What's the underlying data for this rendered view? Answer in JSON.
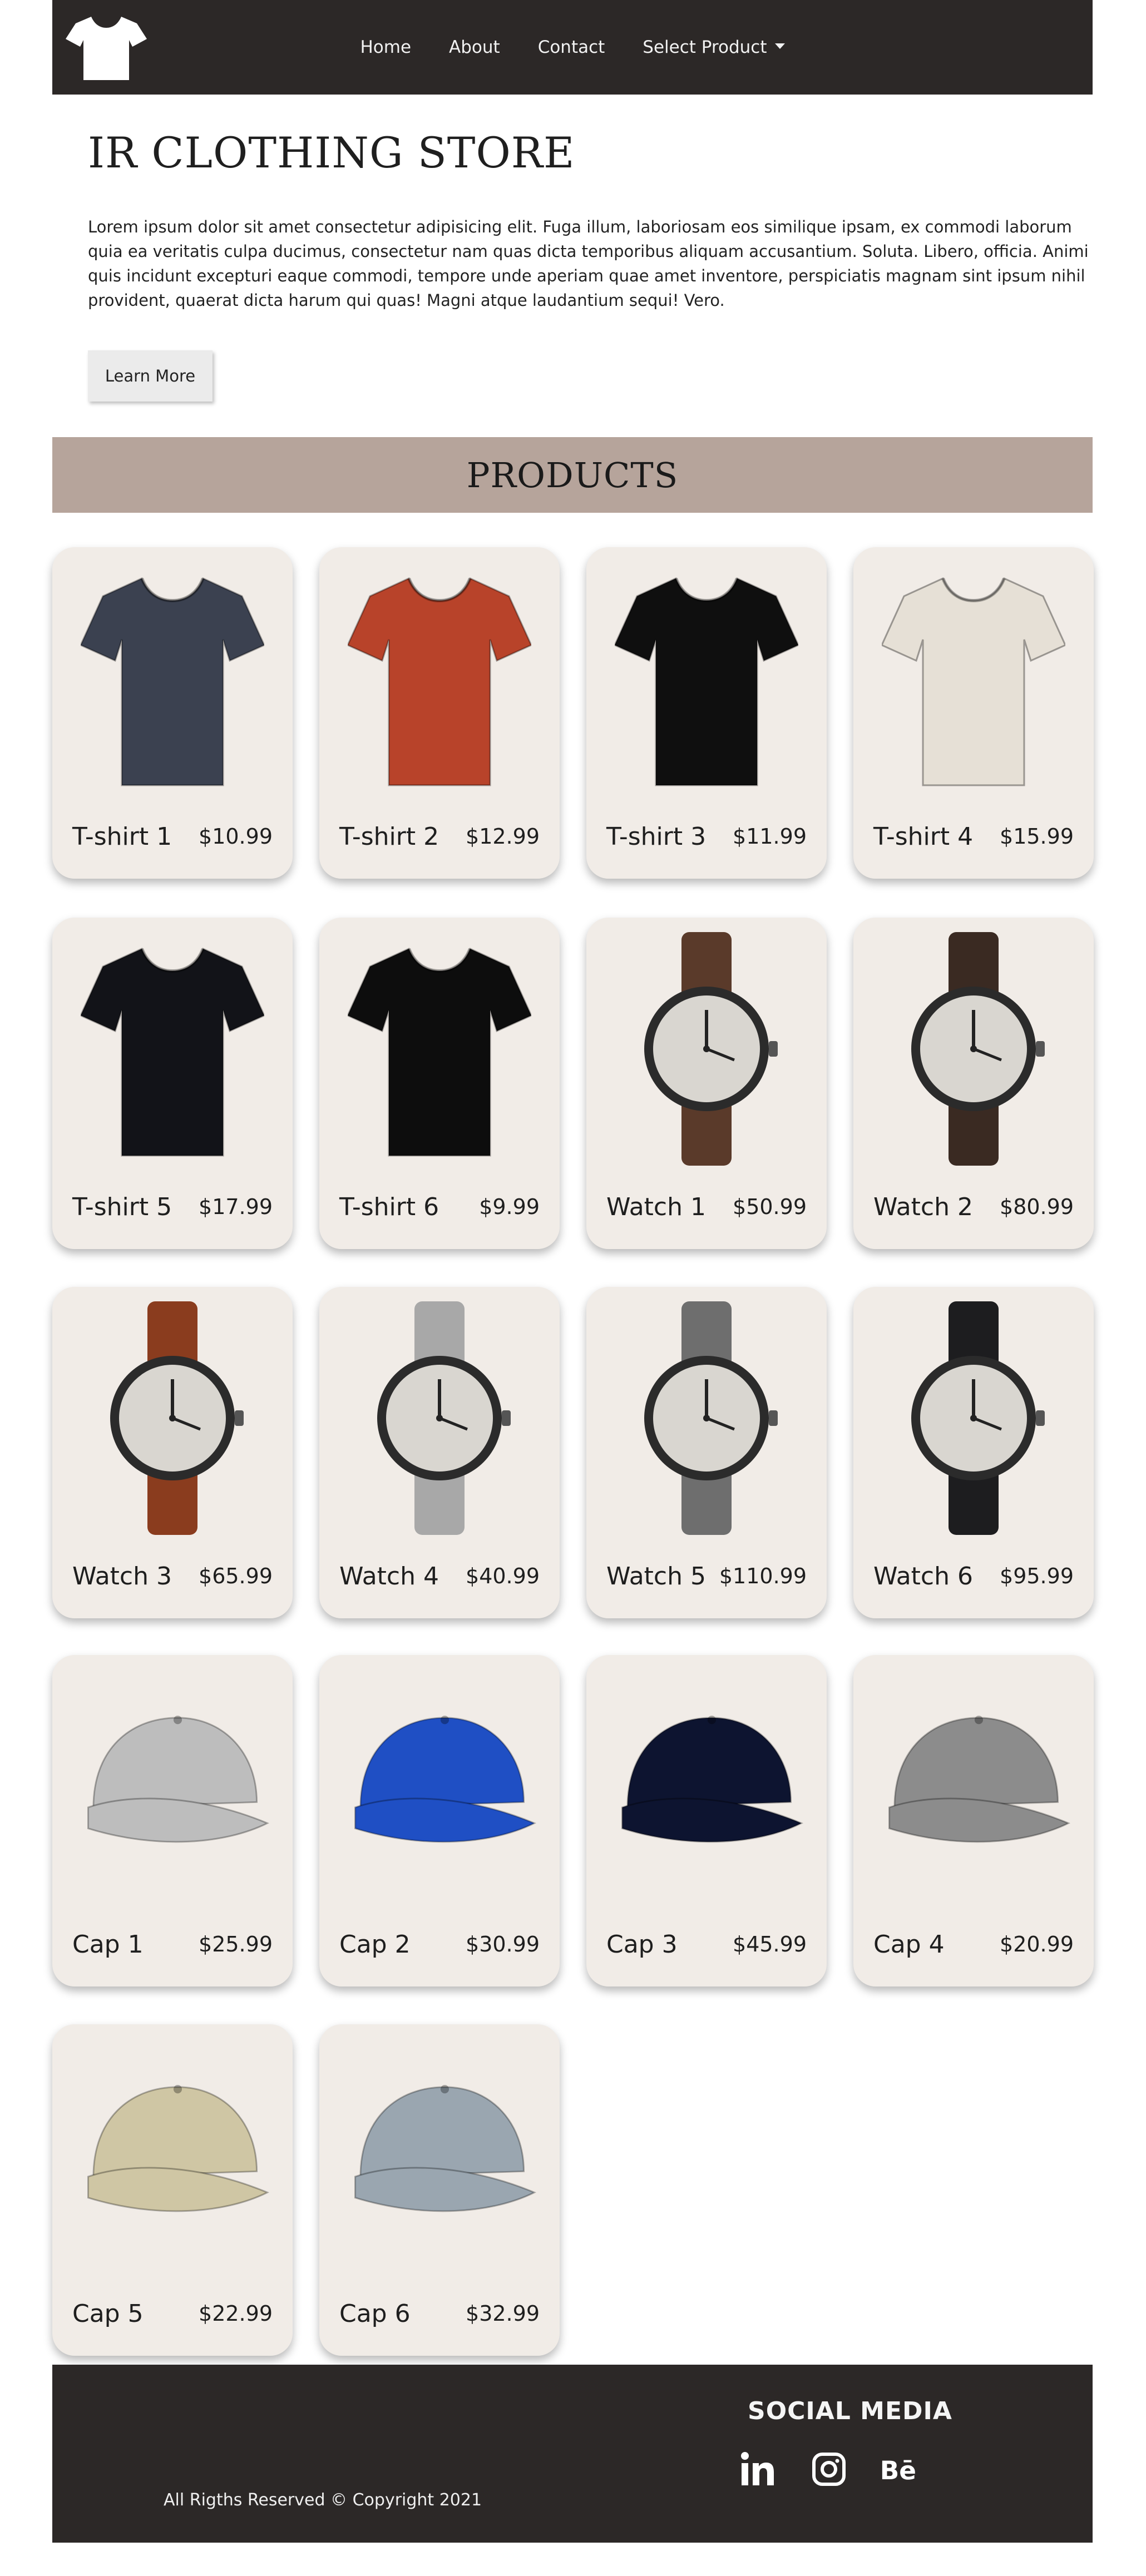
{
  "nav": {
    "logo_icon": "tshirt-icon",
    "links": [
      {
        "label": "Home"
      },
      {
        "label": "About"
      },
      {
        "label": "Contact"
      },
      {
        "label": "Select Product"
      }
    ]
  },
  "hero": {
    "title": "IR CLOTHING STORE",
    "text": "Lorem ipsum dolor sit amet consectetur adipisicing elit. Fuga illum, laboriosam eos similique ipsam, ex commodi laborum quia ea veritatis culpa ducimus, consectetur nam quas dicta temporibus aliquam accusantium. Soluta. Libero, officia. Animi quis incidunt excepturi eaque commodi, tempore unde aperiam quae amet inventore, perspiciatis magnam sint ipsum nihil provident, quaerat dicta harum qui quas! Magni atque laudantium sequi! Vero.",
    "button": "Learn More"
  },
  "products_heading": "PRODUCTS",
  "products": [
    {
      "name": "T-shirt 1",
      "price": "$10.99",
      "kind": "tshirt",
      "color": "#3b4150"
    },
    {
      "name": "T-shirt 2",
      "price": "$12.99",
      "kind": "tshirt",
      "color": "#b8432a"
    },
    {
      "name": "T-shirt 3",
      "price": "$11.99",
      "kind": "tshirt",
      "color": "#0f0f0f"
    },
    {
      "name": "T-shirt 4",
      "price": "$15.99",
      "kind": "tshirt",
      "color": "#e6e0d6"
    },
    {
      "name": "T-shirt 5",
      "price": "$17.99",
      "kind": "tshirt",
      "color": "#121318"
    },
    {
      "name": "T-shirt 6",
      "price": "$9.99",
      "kind": "tshirt",
      "color": "#0d0d0d"
    },
    {
      "name": "Watch 1",
      "price": "$50.99",
      "kind": "watch",
      "color": "#5a3a2a"
    },
    {
      "name": "Watch 2",
      "price": "$80.99",
      "kind": "watch",
      "color": "#3a2a22"
    },
    {
      "name": "Watch 3",
      "price": "$65.99",
      "kind": "watch",
      "color": "#8a3c1e"
    },
    {
      "name": "Watch 4",
      "price": "$40.99",
      "kind": "watch",
      "color": "#a8a8a8"
    },
    {
      "name": "Watch 5",
      "price": "$110.99",
      "kind": "watch",
      "color": "#6e6e6e"
    },
    {
      "name": "Watch 6",
      "price": "$95.99",
      "kind": "watch",
      "color": "#1d1d1f"
    },
    {
      "name": "Cap 1",
      "price": "$25.99",
      "kind": "cap",
      "color": "#bdbdbd"
    },
    {
      "name": "Cap 2",
      "price": "$30.99",
      "kind": "cap",
      "color": "#1f4fc4"
    },
    {
      "name": "Cap 3",
      "price": "$45.99",
      "kind": "cap",
      "color": "#0d1430"
    },
    {
      "name": "Cap 4",
      "price": "$20.99",
      "kind": "cap",
      "color": "#8c8c8c"
    },
    {
      "name": "Cap 5",
      "price": "$22.99",
      "kind": "cap",
      "color": "#cfc6a4"
    },
    {
      "name": "Cap 6",
      "price": "$32.99",
      "kind": "cap",
      "color": "#9aa6b0"
    }
  ],
  "footer": {
    "social_title": "SOCIAL MEDIA",
    "icons": [
      "linkedin-icon",
      "instagram-icon",
      "behance-icon"
    ],
    "copyright": "All Rigths Reserved © Copyright 2021"
  }
}
